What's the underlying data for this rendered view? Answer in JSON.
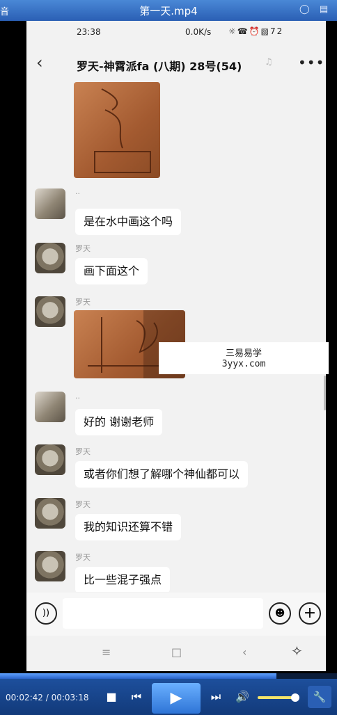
{
  "window": {
    "app_label": "音",
    "title": "第一天.mp4",
    "chat_icon": "speech-bubble-icon",
    "menu_icon": "menu-icon"
  },
  "status_bar": {
    "time": "23:38",
    "network": "0.0K/s",
    "battery": "72"
  },
  "chat": {
    "title": "罗天-神霄派fa (八期) 28号(54)"
  },
  "messages": [
    {
      "type": "image",
      "sender": ""
    },
    {
      "type": "text",
      "sender": "..",
      "text": "是在水中画这个吗"
    },
    {
      "type": "text",
      "sender": "罗天",
      "text": "画下面这个"
    },
    {
      "type": "image",
      "sender": "罗天"
    },
    {
      "type": "text",
      "sender": "..",
      "text": "好的 谢谢老师"
    },
    {
      "type": "text",
      "sender": "罗天",
      "text": "或者你们想了解哪个神仙都可以"
    },
    {
      "type": "text",
      "sender": "罗天",
      "text": "我的知识还算不错"
    },
    {
      "type": "text",
      "sender": "罗天",
      "text": "比一些混子强点"
    }
  ],
  "watermark": {
    "line1": "三易易学",
    "line2": "3yyx.com"
  },
  "player": {
    "current_time": "00:02:42",
    "total_time": "00:03:18",
    "progress": 0.82,
    "volume": 0.9
  },
  "colors": {
    "titlebar": "#2a5fb4",
    "bubble": "#ffffff",
    "chat_bg": "#f2f2f2",
    "player": "#123a7a"
  }
}
